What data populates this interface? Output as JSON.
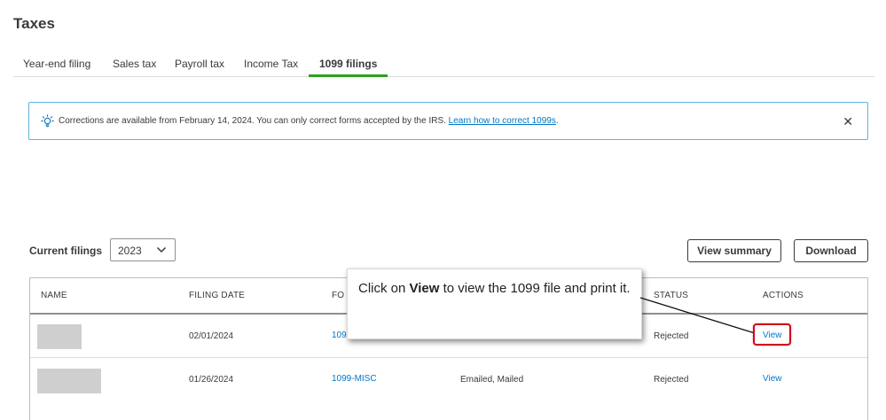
{
  "page": {
    "title": "Taxes"
  },
  "tabs": [
    {
      "label": "Year-end filing",
      "active": false
    },
    {
      "label": "Sales tax",
      "active": false
    },
    {
      "label": "Payroll tax",
      "active": false
    },
    {
      "label": "Income Tax",
      "active": false
    },
    {
      "label": "1099 filings",
      "active": true
    }
  ],
  "banner": {
    "icon": "lightbulb-icon",
    "text": "Corrections are available from February 14, 2024. You can only correct forms accepted by the IRS.",
    "link": "Learn how to correct 1099s",
    "suffix": ".",
    "close": "✕",
    "border_color": "#63b2d6"
  },
  "filings": {
    "label": "Current filings",
    "year": "2023",
    "view_summary": "View summary",
    "download": "Download"
  },
  "table": {
    "columns": [
      "NAME",
      "FILING DATE",
      "FO",
      "STATUS",
      "ACTIONS"
    ],
    "rows": [
      {
        "filing_date": "02/01/2024",
        "form": "109",
        "delivery": "",
        "status": "Rejected",
        "action": "View"
      },
      {
        "filing_date": "01/26/2024",
        "form": "1099-MISC",
        "delivery": "Emailed, Mailed",
        "status": "Rejected",
        "action": "View"
      }
    ]
  },
  "callout": {
    "prefix": "Click on ",
    "bold": "View",
    "suffix": " to view the 1099 file and print it."
  },
  "colors": {
    "accent_green": "#2ca01c",
    "link_blue": "#0077c5",
    "highlight_red": "#d0021b",
    "text": "#393a3d"
  }
}
